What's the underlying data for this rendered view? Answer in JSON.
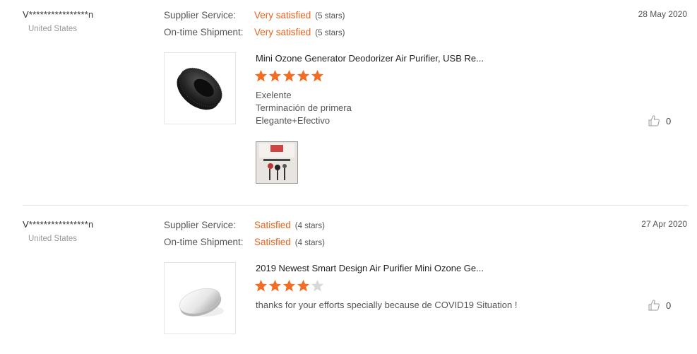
{
  "reviews": [
    {
      "user": "V****************n",
      "country": "United States",
      "date": "28 May 2020",
      "ratings": [
        {
          "label": "Supplier Service:",
          "value": "Very satisfied",
          "stars_text": "(5 stars)"
        },
        {
          "label": "On-time Shipment:",
          "value": "Very satisfied",
          "stars_text": "(5 stars)"
        }
      ],
      "product_title": "Mini Ozone Generator Deodorizer Air Purifier, USB Re...",
      "stars": 5,
      "feedback": [
        "Exelente",
        "Terminación de primera",
        "Elegante+Efectivo"
      ],
      "helpful_count": "0",
      "product_image": "black-round-air-purifier",
      "photo_attached": "customer-photo-thumbnail"
    },
    {
      "user": "V****************n",
      "country": "United States",
      "date": "27 Apr 2020",
      "ratings": [
        {
          "label": "Supplier Service:",
          "value": "Satisfied",
          "stars_text": "(4 stars)"
        },
        {
          "label": "On-time Shipment:",
          "value": "Satisfied",
          "stars_text": "(4 stars)"
        }
      ],
      "product_title": "2019 Newest Smart Design Air Purifier Mini Ozone Ge...",
      "stars": 4,
      "feedback": [
        "thanks for your efforts specially because de COVID19 Situation !"
      ],
      "helpful_count": "0",
      "product_image": "white-disc-air-purifier"
    }
  ],
  "colors": {
    "accent": "#e8621c",
    "star_filled": "#f26d21",
    "star_empty": "#d8d8d8",
    "divider": "#e3e3e3"
  }
}
